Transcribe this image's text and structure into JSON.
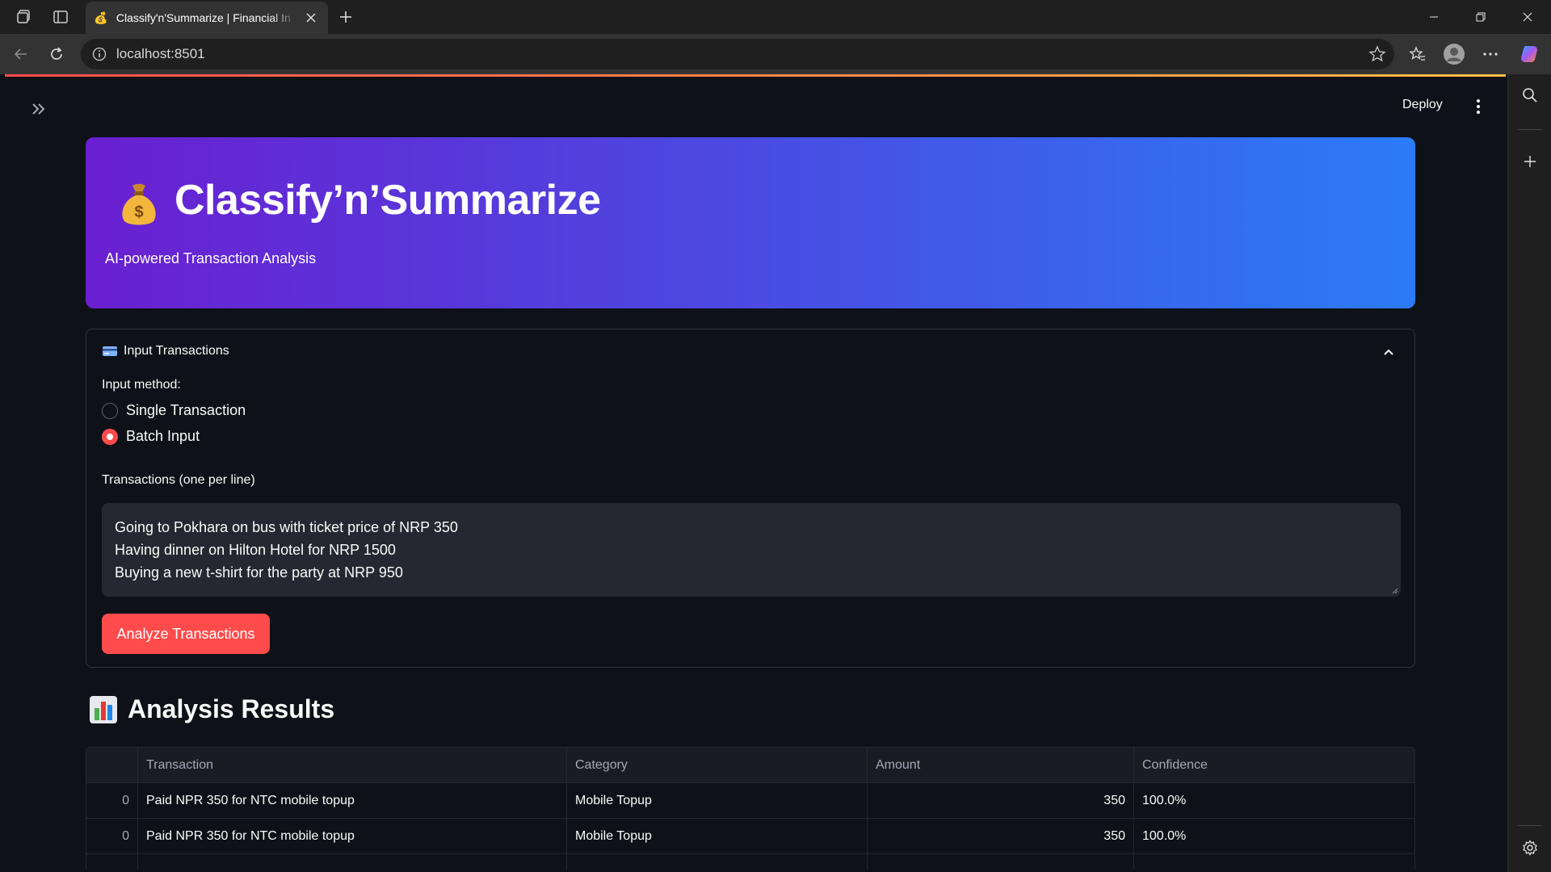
{
  "browser": {
    "tab_title": "Classify'n'Summarize | Financial In",
    "tab_favicon": "💰",
    "address": "localhost:8501"
  },
  "app": {
    "deploy_label": "Deploy",
    "hero": {
      "emoji": "money-bag-icon",
      "title": "Classify’n’Summarize",
      "subtitle": "AI-powered Transaction Analysis"
    },
    "expander": {
      "icon": "credit-card-icon",
      "title": "Input Transactions",
      "input_method_label": "Input method:",
      "options": [
        "Single Transaction",
        "Batch Input"
      ],
      "selected_option": "Batch Input",
      "textarea_label": "Transactions (one per line)",
      "textarea_lines": [
        "Going to Pokhara on bus with ticket price of NRP 350",
        "Having dinner on Hilton Hotel for NRP 1500",
        "Buying a new t-shirt for the party at NRP 950"
      ],
      "button_label": "Analyze Transactions"
    },
    "results": {
      "icon": "bar-chart-icon",
      "title": "Analysis Results",
      "columns": [
        "",
        "Transaction",
        "Category",
        "Amount",
        "Confidence"
      ],
      "rows": [
        {
          "index": "0",
          "transaction": "Paid NPR 350 for NTC mobile topup",
          "category": "Mobile Topup",
          "amount": "350",
          "confidence": "100.0%"
        },
        {
          "index": "0",
          "transaction": "Paid NPR 350 for NTC mobile topup",
          "category": "Mobile Topup",
          "amount": "350",
          "confidence": "100.0%"
        }
      ]
    }
  },
  "colors": {
    "accent": "#ff4b4b",
    "background": "#0e1117",
    "hero_gradient_start": "#6a1fd0",
    "hero_gradient_end": "#2b7bf6"
  }
}
